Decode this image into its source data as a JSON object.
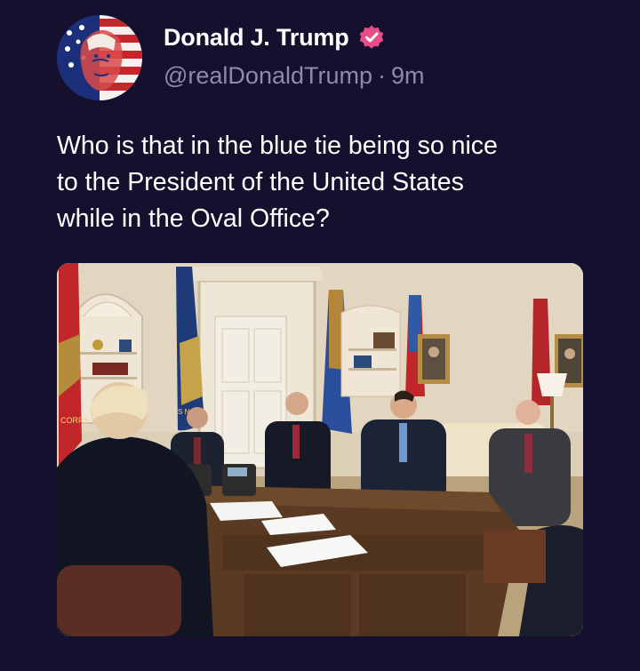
{
  "author": {
    "display_name": "Donald J. Trump",
    "handle": "@realDonaldTrump",
    "separator": "·",
    "timestamp": "9m",
    "verified": true,
    "verified_badge_color": "#e94d88",
    "avatar_icon": "american-flag-portrait"
  },
  "post": {
    "lines": [
      "Who is that in the blue tie being so nice",
      "to the President of the United States",
      "while in the Oval Office?"
    ]
  },
  "media": {
    "type": "photo",
    "subject": "oval-office-meeting",
    "flag_text_navy": "S NAVY",
    "flag_text_corps": "CORPS"
  },
  "colors": {
    "background": "#15102e",
    "text": "#ffffff",
    "muted_text": "#8e8aa8"
  }
}
